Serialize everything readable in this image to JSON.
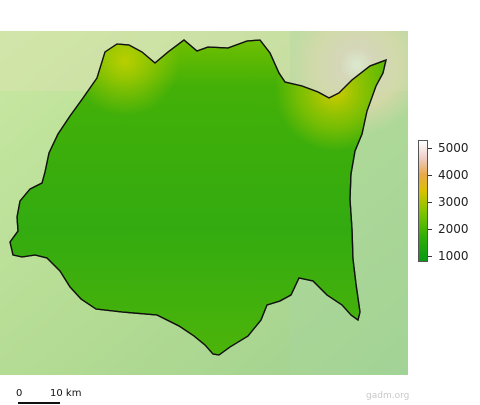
{
  "legend": {
    "labels": [
      "5000",
      "4000",
      "3000",
      "2000",
      "1000"
    ],
    "colors": {
      "low": "#0a9a14",
      "mid": "#7cc500",
      "high": "#e9a84a",
      "top": "#ffffff"
    }
  },
  "scale": {
    "zero": "0",
    "distance": "10 km"
  },
  "credit": "gadm.org",
  "colors": {
    "outline": "#111111",
    "background_terrain": "#b9df8e",
    "region_fill": "#33ad12"
  }
}
